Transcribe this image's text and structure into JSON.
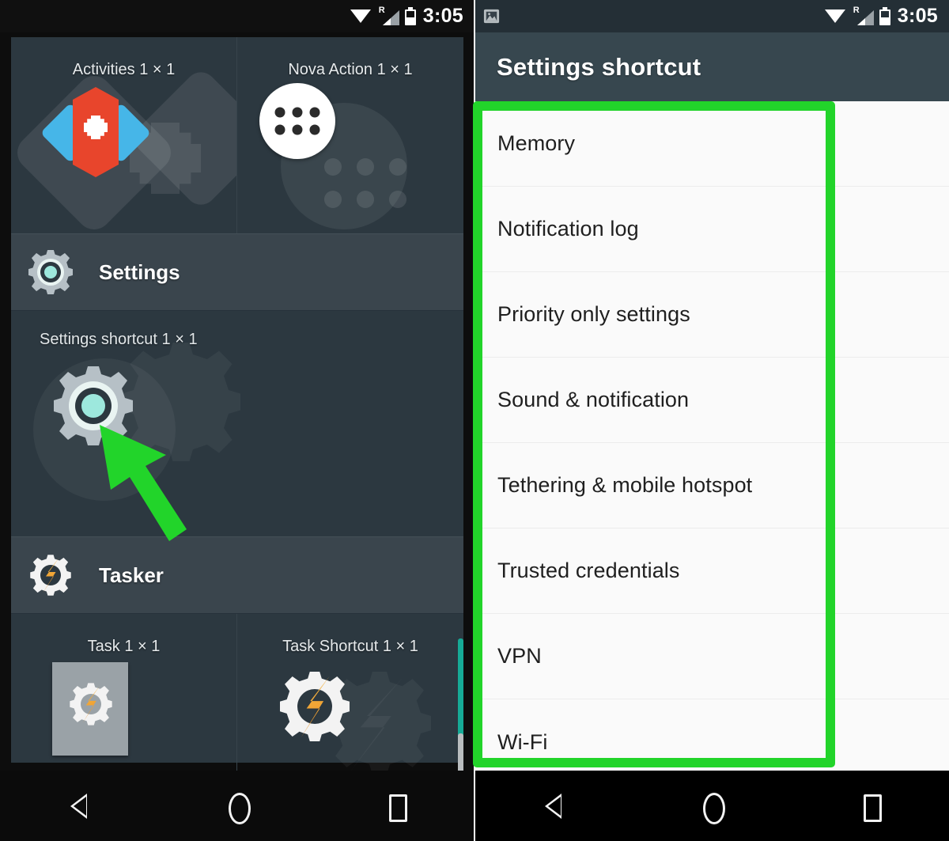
{
  "left_phone": {
    "statusbar": {
      "time": "3:05",
      "icons": [
        "wifi-icon",
        "signal-roaming-icon",
        "battery-icon"
      ]
    },
    "widget_picker": {
      "groups": [
        {
          "app_name": "",
          "widgets": [
            {
              "label": "Activities  1 × 1",
              "icon": "activities-widget-icon"
            },
            {
              "label": "Nova Action  1 × 1",
              "icon": "nova-action-widget-icon"
            }
          ]
        },
        {
          "app_name": "Settings",
          "app_icon": "settings-gear-icon",
          "widgets": [
            {
              "label": "Settings shortcut  1 × 1",
              "icon": "settings-shortcut-gear-icon"
            }
          ]
        },
        {
          "app_name": "Tasker",
          "app_icon": "tasker-icon",
          "widgets": [
            {
              "label": "Task  1 × 1",
              "icon": "tasker-task-icon"
            },
            {
              "label": "Task Shortcut  1 × 1",
              "icon": "tasker-task-shortcut-icon"
            }
          ]
        }
      ]
    },
    "navbar": {
      "back": "back-icon",
      "home": "home-icon",
      "recents": "recents-icon"
    }
  },
  "right_phone": {
    "statusbar": {
      "time": "3:05",
      "notification_icon": "screenshot-image-icon",
      "icons": [
        "wifi-icon",
        "signal-roaming-icon",
        "battery-icon"
      ]
    },
    "appbar": {
      "title": "Settings shortcut"
    },
    "list": {
      "items": [
        {
          "label": "Memory"
        },
        {
          "label": "Notification log"
        },
        {
          "label": "Priority only settings"
        },
        {
          "label": "Sound & notification"
        },
        {
          "label": "Tethering & mobile hotspot"
        },
        {
          "label": "Trusted credentials"
        },
        {
          "label": "VPN"
        },
        {
          "label": "Wi-Fi"
        }
      ]
    },
    "navbar": {
      "back": "back-icon",
      "home": "home-icon",
      "recents": "recents-icon"
    }
  },
  "annotations": {
    "highlight_color": "#22d42a",
    "arrow_color": "#22d42a",
    "arrow_target": "settings-shortcut-gear-icon",
    "highlight_target": "settings-shortcut-list"
  },
  "colors": {
    "panel_bg": "#2c3840",
    "header_row_bg": "#3a454d",
    "appbar_bg": "#37474f",
    "list_bg": "#fafafa",
    "accent_green": "#22d42a",
    "scrollbar_teal": "#16aa96"
  }
}
